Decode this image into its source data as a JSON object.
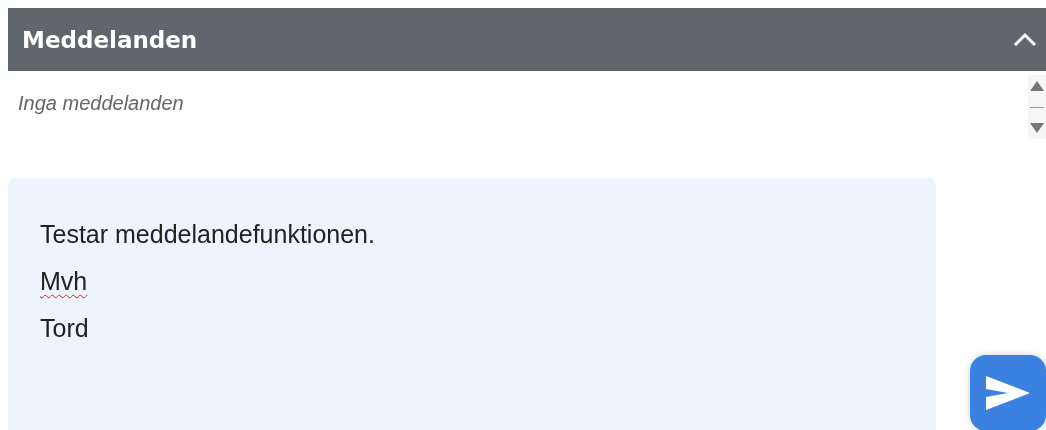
{
  "panel": {
    "title": "Meddelanden",
    "expanded": true,
    "empty_text": "Inga meddelanden"
  },
  "composer": {
    "lines": [
      {
        "text": "Testar meddelandefunktionen.",
        "misspelled": false
      },
      {
        "text": "Mvh",
        "misspelled": true
      },
      {
        "text": "Tord",
        "misspelled": false
      }
    ]
  }
}
